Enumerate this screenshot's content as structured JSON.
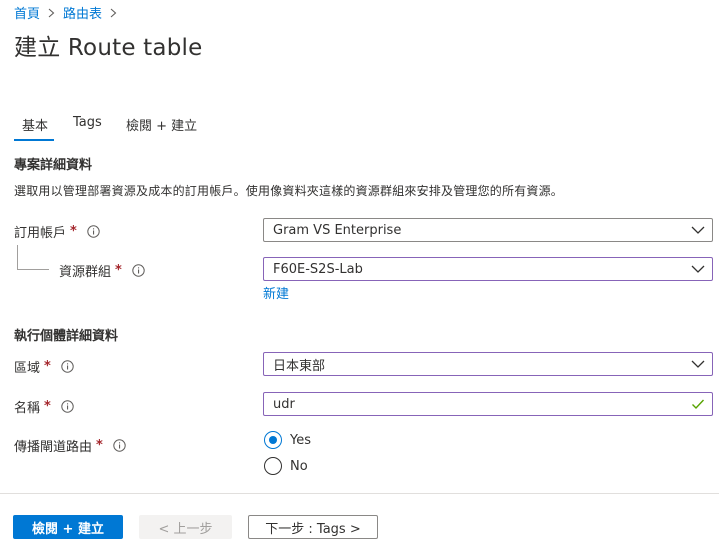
{
  "breadcrumb": {
    "home": "首頁",
    "route_tables": "路由表"
  },
  "page": {
    "title": "建立 Route table"
  },
  "tabs": [
    {
      "label": "基本"
    },
    {
      "label": "Tags"
    },
    {
      "label": "檢閱 + 建立"
    }
  ],
  "project_details": {
    "heading": "專案詳細資料",
    "description": "選取用以管理部署資源及成本的訂用帳戶。使用像資料夾這樣的資源群組來安排及管理您的所有資源。",
    "subscription": {
      "label": "訂用帳戶",
      "value": "Gram VS Enterprise"
    },
    "resource_group": {
      "label": "資源群組",
      "value": "F60E-S2S-Lab",
      "new_link": "新建"
    }
  },
  "instance_details": {
    "heading": "執行個體詳細資料",
    "region": {
      "label": "區域",
      "value": "日本東部"
    },
    "name": {
      "label": "名稱",
      "value": "udr"
    },
    "propagate": {
      "label": "傳播閘道路由",
      "options": [
        "Yes",
        "No"
      ],
      "selected": "Yes"
    }
  },
  "required_marker": "*",
  "footer": {
    "review_create": "檢閱 + 建立",
    "previous": "< 上一步",
    "next": "下一步 : Tags >"
  },
  "colors": {
    "accent": "#0078d4",
    "active_border": "#8764b8",
    "valid_check": "#57a300",
    "required": "#a4262c"
  }
}
